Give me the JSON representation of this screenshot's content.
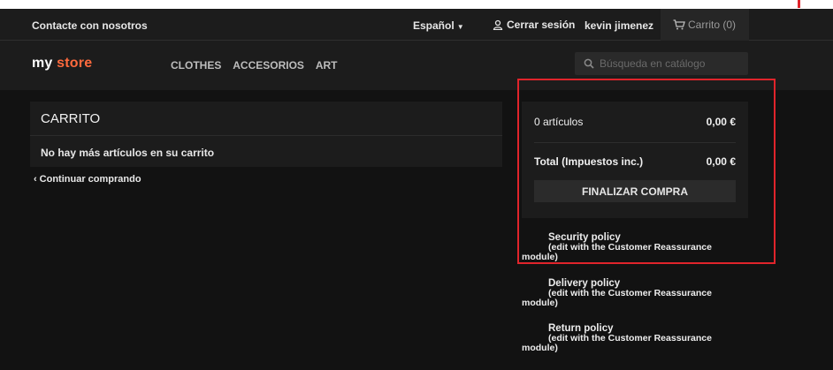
{
  "header": {
    "contact": "Contacte con nosotros",
    "language": "Español",
    "logout": "Cerrar sesión",
    "username": "kevin jimenez",
    "cart": "Carrito (0)"
  },
  "brand": {
    "logo_part1": "my ",
    "logo_part2": "store",
    "accent_color": "#ff6a3d"
  },
  "nav": {
    "items": [
      "CLOTHES",
      "ACCESORIOS",
      "ART"
    ]
  },
  "search": {
    "placeholder": "Búsqueda en catálogo"
  },
  "cart": {
    "title": "CARRITO",
    "empty_message": "No hay más artículos en su carrito",
    "continue_label": "Continuar comprando"
  },
  "summary": {
    "items_label": "0 artículos",
    "items_value": "0,00 €",
    "total_label": "Total (Impuestos inc.)",
    "total_value": "0,00 €",
    "checkout_label": "FINALIZAR COMPRA"
  },
  "reassurance": [
    {
      "title": "Security policy",
      "desc": "(edit with the Customer Reassurance",
      "desc_end": "module)"
    },
    {
      "title": "Delivery policy",
      "desc": "(edit with the Customer Reassurance",
      "desc_end": "module)"
    },
    {
      "title": "Return policy",
      "desc": "(edit with the Customer Reassurance",
      "desc_end": "module)"
    }
  ],
  "annotation": {
    "color": "#e0242b"
  }
}
